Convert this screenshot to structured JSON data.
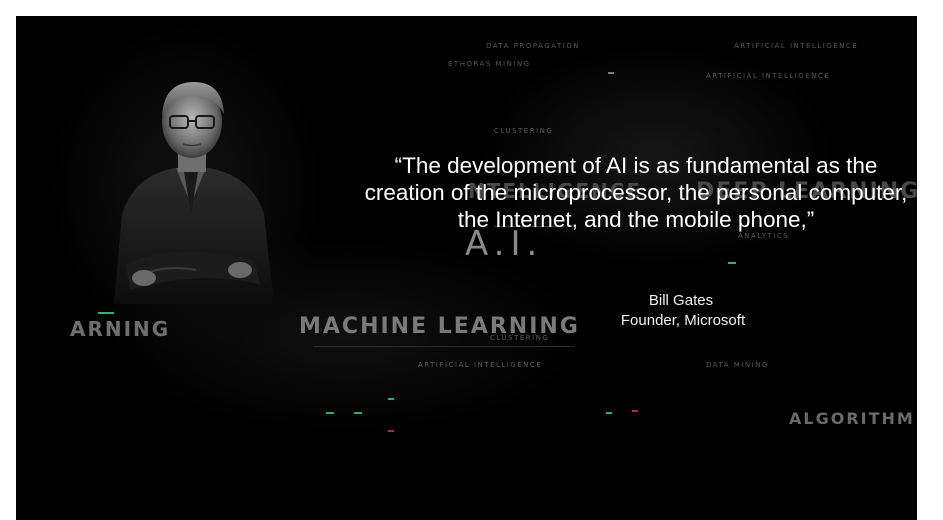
{
  "slide": {
    "quote": "“The development of AI is as fundamental as the creation of the microprocessor, the personal computer, the Internet, and the mobile phone,”",
    "author": "Bill Gates",
    "role": "Founder, Microsoft"
  },
  "background": {
    "machine_learning": "MACHINE LEARNING",
    "learning_left": "ARNING",
    "deep_learning": "DEEP LEARNING",
    "intelligence": "NTELLIGENCE",
    "algorithm": "ALGORITHM",
    "ai": "A.I.",
    "small_labels": {
      "data_propagation": "DATA PROPAGATION",
      "artificial_intelligence_top": "ARTIFICIAL INTELLIGENCE",
      "artificial_intelligence_mid": "ARTIFICIAL INTELLIGENCE",
      "artificial_intelligence_bottom": "ARTIFICIAL INTELLIGENCE",
      "clustering_top": "CLUSTERING",
      "clustering_bottom": "CLUSTERING",
      "analytics": "ANALYTICS",
      "data_mining": "DATA MINING",
      "algorithms_mining": "ETHORAS MINING"
    }
  },
  "colors": {
    "slide_background": "#000000",
    "page_background": "#ffffff",
    "accent_green": "#2ab07a",
    "accent_red": "#b0283a"
  }
}
